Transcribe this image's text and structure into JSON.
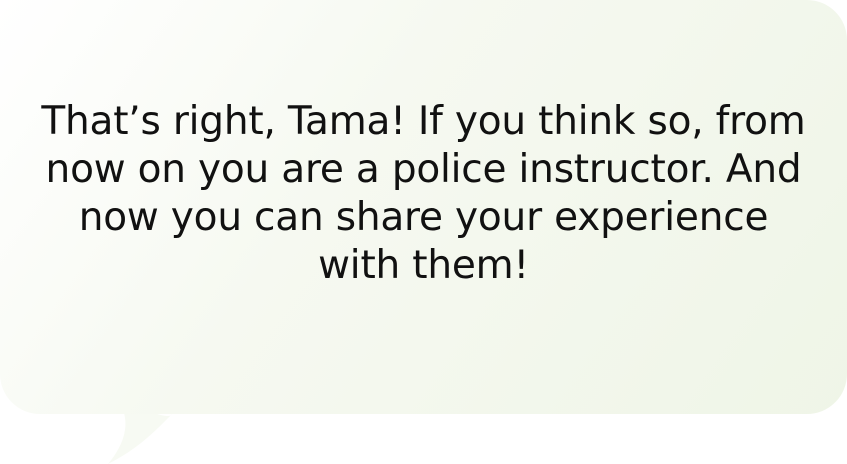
{
  "dialog": {
    "message": "That’s right, Tama! If you think so, from now on you are a police instructor. And now you can share your experience with them!"
  },
  "colors": {
    "bubble_light": "#ffffff",
    "bubble_tint": "#eff5e7",
    "text": "#111111"
  }
}
